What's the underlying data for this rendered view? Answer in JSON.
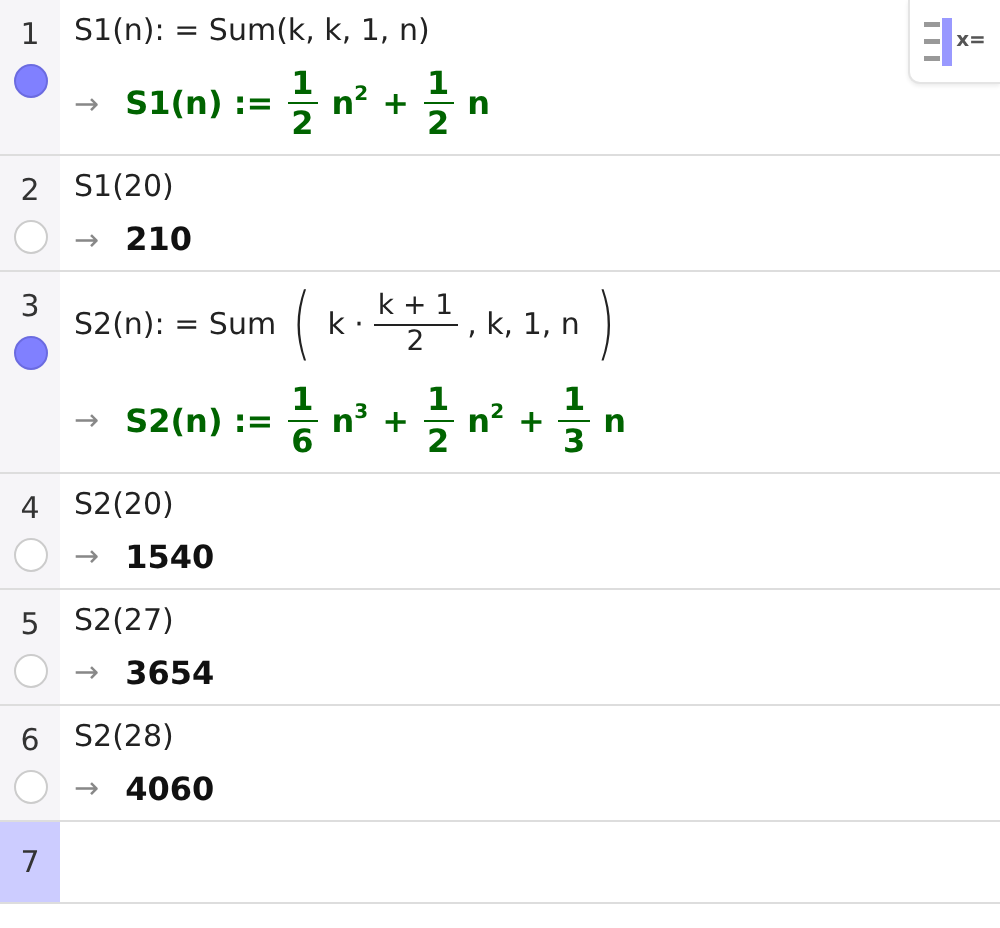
{
  "toggle_button": {
    "label": "x="
  },
  "rows": [
    {
      "number": "1",
      "shown": true,
      "selected": false,
      "input": [
        {
          "kind": "text",
          "text": "S1(n): = Sum(k, k, 1, n)"
        }
      ],
      "output": {
        "kind": "definition",
        "arrow": "→",
        "tokens": [
          {
            "kind": "text",
            "text": "S1(n) :="
          },
          {
            "kind": "frac",
            "num": "1",
            "den": "2"
          },
          {
            "kind": "power",
            "base": "n",
            "exp": "2"
          },
          {
            "kind": "text",
            "text": "+"
          },
          {
            "kind": "frac",
            "num": "1",
            "den": "2"
          },
          {
            "kind": "text",
            "text": "n"
          }
        ]
      }
    },
    {
      "number": "2",
      "shown": false,
      "selected": false,
      "input": [
        {
          "kind": "text",
          "text": "S1(20)"
        }
      ],
      "output": {
        "kind": "value",
        "arrow": "→",
        "tokens": [
          {
            "kind": "text",
            "text": "210"
          }
        ]
      }
    },
    {
      "number": "3",
      "shown": true,
      "selected": false,
      "input": [
        {
          "kind": "text",
          "text": "S2(n): = Sum"
        },
        {
          "kind": "bigparen",
          "text": "("
        },
        {
          "kind": "text",
          "text": "k ·"
        },
        {
          "kind": "frac",
          "num": "k + 1",
          "den": "2"
        },
        {
          "kind": "text",
          "text": ", k, 1, n"
        },
        {
          "kind": "bigparen",
          "text": ")"
        }
      ],
      "output": {
        "kind": "definition",
        "arrow": "→",
        "tokens": [
          {
            "kind": "text",
            "text": "S2(n) :="
          },
          {
            "kind": "frac",
            "num": "1",
            "den": "6"
          },
          {
            "kind": "power",
            "base": "n",
            "exp": "3"
          },
          {
            "kind": "text",
            "text": "+"
          },
          {
            "kind": "frac",
            "num": "1",
            "den": "2"
          },
          {
            "kind": "power",
            "base": "n",
            "exp": "2"
          },
          {
            "kind": "text",
            "text": "+"
          },
          {
            "kind": "frac",
            "num": "1",
            "den": "3"
          },
          {
            "kind": "text",
            "text": "n"
          }
        ]
      }
    },
    {
      "number": "4",
      "shown": false,
      "selected": false,
      "input": [
        {
          "kind": "text",
          "text": "S2(20)"
        }
      ],
      "output": {
        "kind": "value",
        "arrow": "→",
        "tokens": [
          {
            "kind": "text",
            "text": "1540"
          }
        ]
      }
    },
    {
      "number": "5",
      "shown": false,
      "selected": false,
      "input": [
        {
          "kind": "text",
          "text": "S2(27)"
        }
      ],
      "output": {
        "kind": "value",
        "arrow": "→",
        "tokens": [
          {
            "kind": "text",
            "text": "3654"
          }
        ]
      }
    },
    {
      "number": "6",
      "shown": false,
      "selected": false,
      "input": [
        {
          "kind": "text",
          "text": "S2(28)"
        }
      ],
      "output": {
        "kind": "value",
        "arrow": "→",
        "tokens": [
          {
            "kind": "text",
            "text": "4060"
          }
        ]
      }
    },
    {
      "number": "7",
      "selected": true
    }
  ]
}
